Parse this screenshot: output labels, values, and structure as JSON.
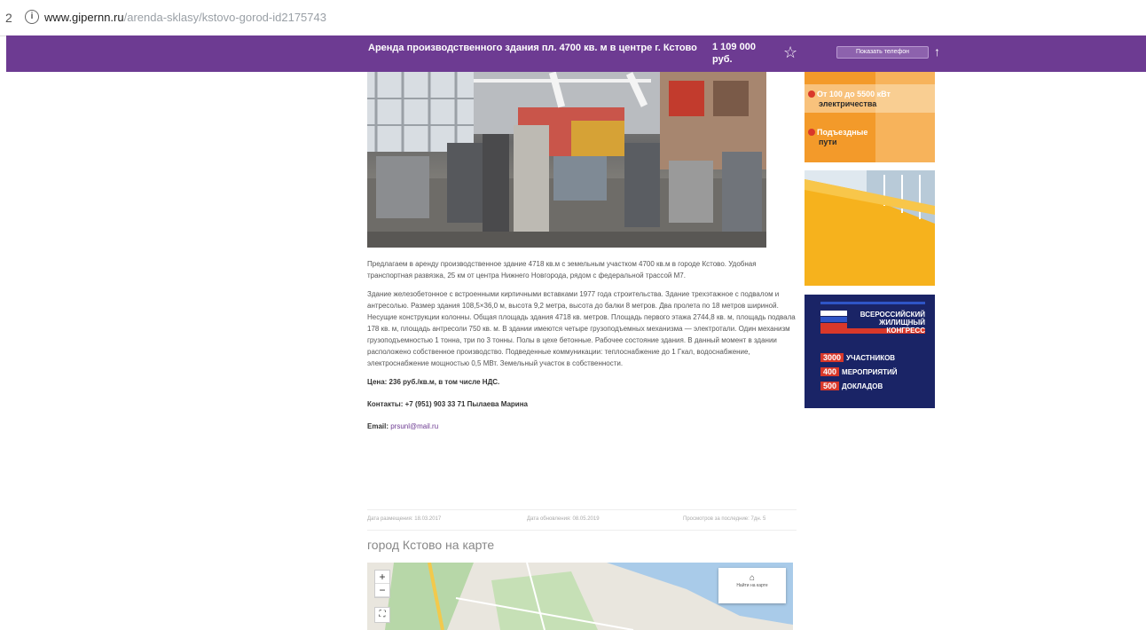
{
  "browser": {
    "nav_glyph": "2",
    "info_glyph": "i",
    "url_domain": "www.gipernn.ru",
    "url_path": "/arenda-sklasy/kstovo-gorod-id2175743"
  },
  "header": {
    "title": "Аренда производственного здания пл. 4700 кв. м в центре г. Кстово",
    "price": "1 109 000 руб.",
    "star_glyph": "☆",
    "contact_button": "Показать телефон",
    "arrow_glyph": "↑"
  },
  "description": {
    "p1": "Предлагаем в аренду производственное здание 4718 кв.м с земельным участком 4700 кв.м в городе Кстово. Удобная транспортная развязка, 25 км от центра Нижнего Новгорода, рядом с федеральной трассой М7.",
    "p2": "Здание железобетонное с встроенными кирпичными вставками 1977 года строительства. Здание трехэтажное с подвалом и антресолью. Размер здания 108,5×36,0 м, высота 9,2 метра, высота до балки 8 метров. Два пролета по 18 метров шириной. Несущие конструкции колонны. Общая площадь здания 4718 кв. метров. Площадь первого этажа 2744,8 кв. м, площадь подвала 178 кв. м, площадь антресоли 750 кв. м. В здании имеются четыре грузоподъемных механизма — электротали. Один механизм грузоподъемностью 1 тонна, три по 3 тонны. Полы в цехе бетонные. Рабочее состояние здания. В данный момент в здании расположено собственное производство. Подведенные коммуникации: теплоснабжение до 1 Гкал, водоснабжение, электроснабжение мощностью 0,5 МВт. Земельный участок в собственности.",
    "price_line": "Цена: 236 руб./кв.м, в том числе НДС.",
    "contacts_line": "Контакты: +7 (951) 903 33 71 Пылаева Марина",
    "email_label": "Email: ",
    "email_value": "prsunl@mail.ru"
  },
  "meta": {
    "created": "Дата размещения: 18.03.2017",
    "updated": "Дата обновления: 08.05.2019",
    "views": "Просмотров за последние: 7дн. 5"
  },
  "map": {
    "title": "город Кстово на карте",
    "zoom_in": "+",
    "zoom_out": "−",
    "fullscreen": "⛶",
    "panel_icon": "⌂",
    "panel_label": "Найти на карте"
  },
  "ads": {
    "ad1_line1_hl": "От 100 до 5500 кВт",
    "ad1_line1_rest": "электричества",
    "ad1_line2_hl": "Подъездные",
    "ad1_line2_rest": "пути",
    "ad3_heading_1": "ВСЕРОССИЙСКИЙ",
    "ad3_heading_2": "ЖИЛИЩНЫЙ",
    "ad3_heading_3": "КОНГРЕСС",
    "ad3_n1": "3000",
    "ad3_l1": "УЧАСТНИКОВ",
    "ad3_n2": "400",
    "ad3_l2": "МЕРОПРИЯТИЙ",
    "ad3_n3": "500",
    "ad3_l3": "ДОКЛАДОВ"
  },
  "colors": {
    "brand_purple": "#6d3b92",
    "ad_orange": "#f39a2a",
    "ad_yellow": "#f6b21d",
    "ad_navy": "#1a2466",
    "accent_red": "#d9382a"
  }
}
